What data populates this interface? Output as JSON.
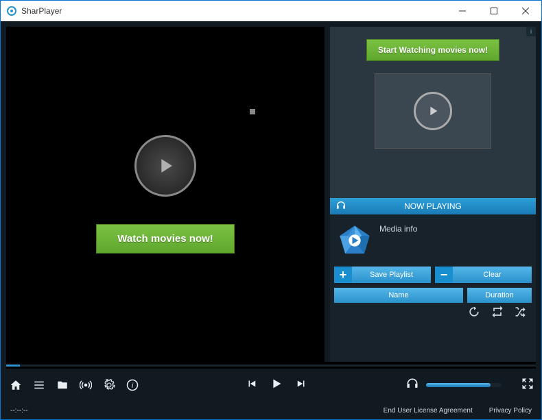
{
  "window": {
    "title": "SharPlayer"
  },
  "video": {
    "watch_button": "Watch movies now!"
  },
  "ad": {
    "button": "Start Watching movies now!",
    "marker": "i"
  },
  "now_playing": {
    "header": "NOW PLAYING",
    "media_info": "Media info"
  },
  "playlist": {
    "save": "Save Playlist",
    "clear": "Clear",
    "col_name": "Name",
    "col_duration": "Duration"
  },
  "footer": {
    "time": "--:--:--",
    "eula": "End User License Agreement",
    "privacy": "Privacy Policy"
  },
  "icons": {
    "plus": "+",
    "minus": "−"
  }
}
